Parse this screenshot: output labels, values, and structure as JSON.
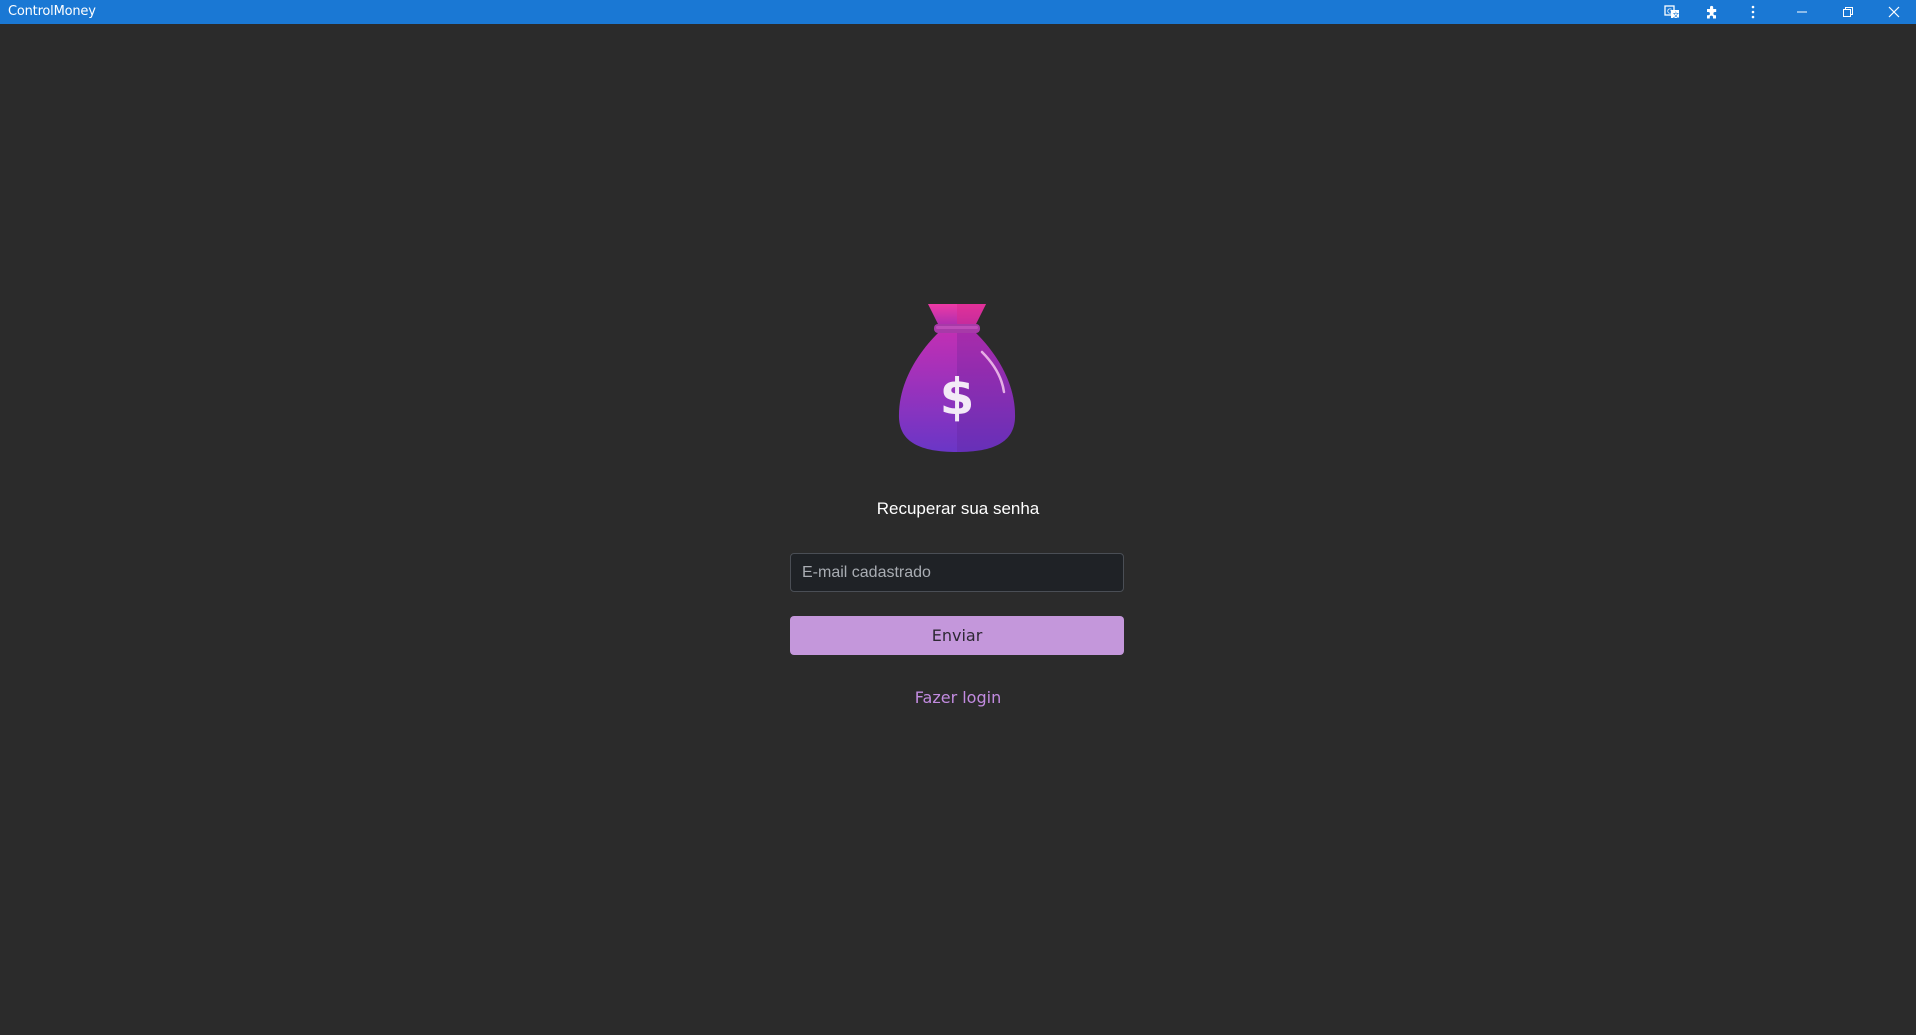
{
  "window": {
    "title": "ControlMoney",
    "controls": {
      "translate_icon": "translate-icon",
      "extensions_icon": "puzzle-icon",
      "menu_icon": "more-vertical-icon",
      "minimize_icon": "minimize-icon",
      "restore_icon": "restore-icon",
      "close_icon": "close-icon"
    },
    "accent_color": "#1a78d4"
  },
  "recover": {
    "logo_icon": "money-bag-icon",
    "heading": "Recuperar sua senha",
    "email_placeholder": "E-mail cadastrado",
    "email_value": "",
    "submit_label": "Enviar",
    "login_link": "Fazer login"
  },
  "colors": {
    "background": "#2b2b2b",
    "button": "#c497db",
    "link": "#c28be0"
  }
}
